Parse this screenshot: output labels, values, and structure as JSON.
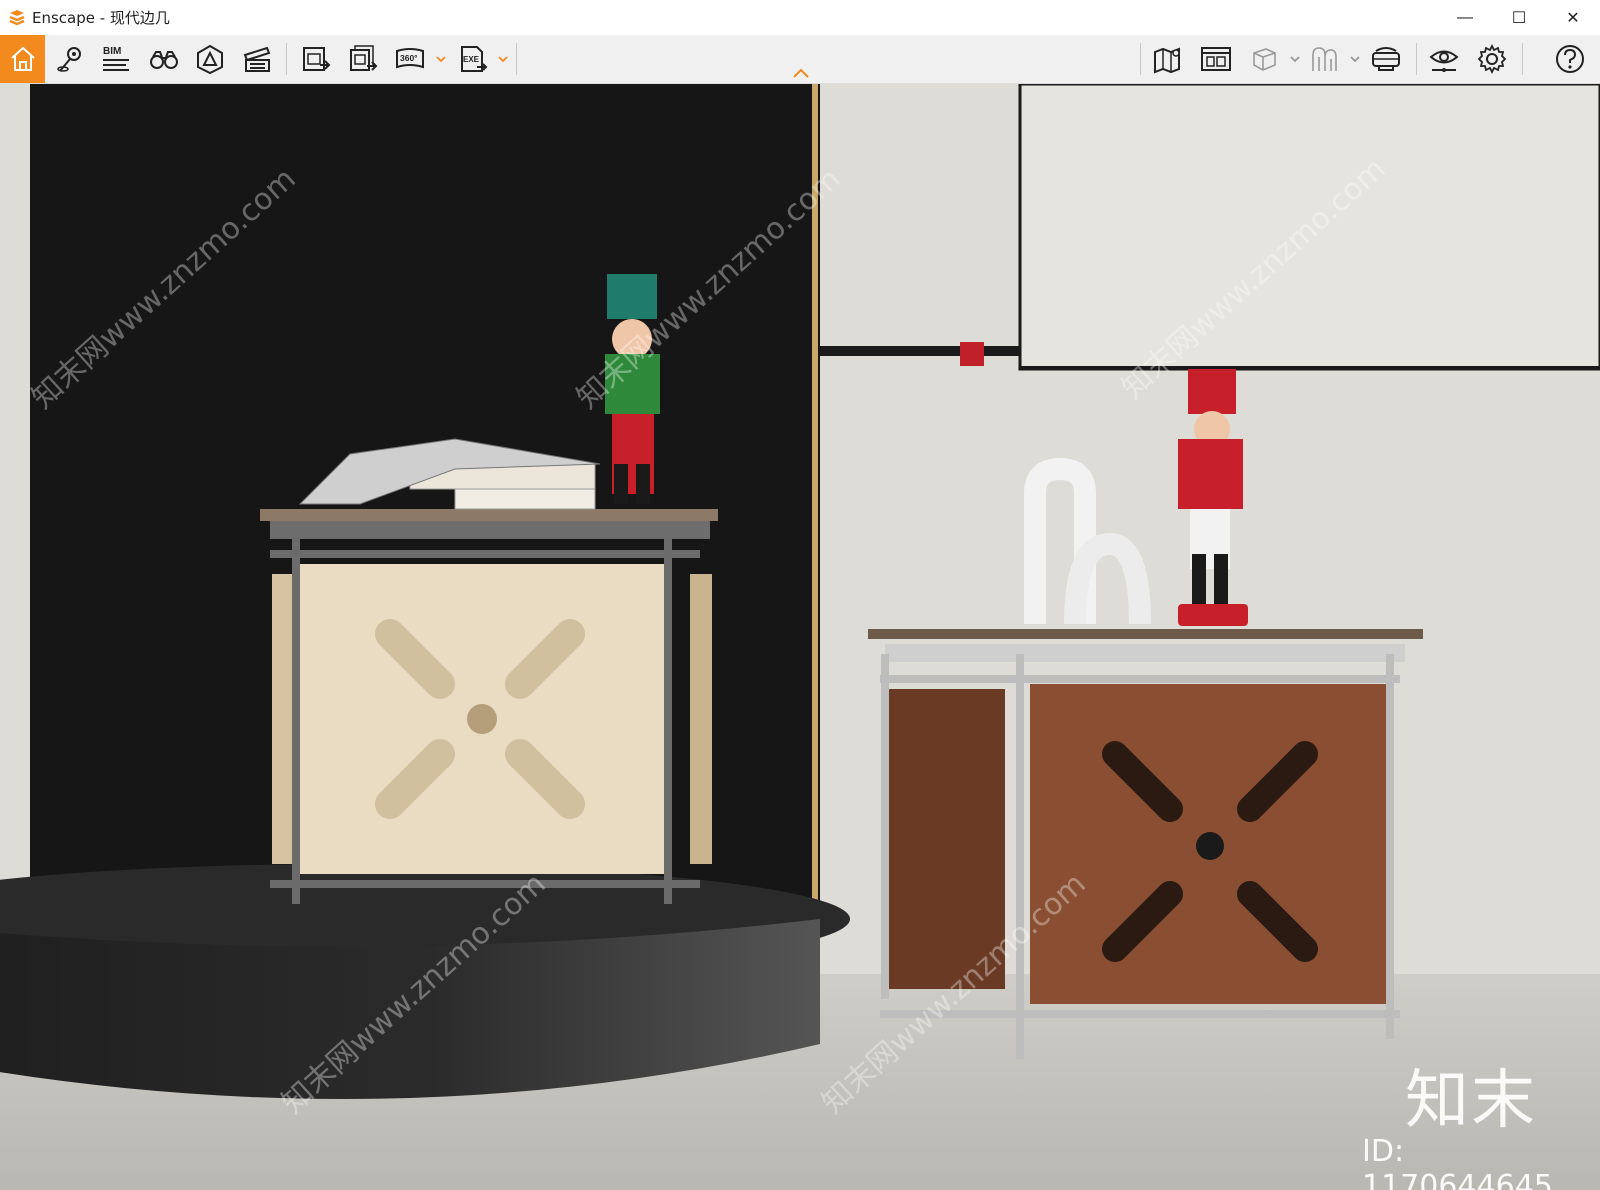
{
  "window": {
    "app_name": "Enscape",
    "title": "Enscape - 现代边几",
    "controls": {
      "minimize": "—",
      "maximize": "☐",
      "close": "✕"
    }
  },
  "toolbar": {
    "bim_label": "BIM",
    "pano_label": "360°",
    "exe_label": "EXE",
    "accent_color": "#f28a1e",
    "icons": [
      "home-icon",
      "location-pin-icon",
      "bim-info-icon",
      "binoculars-icon",
      "visual-settings-icon",
      "video-editor-icon",
      "render-image-icon",
      "batch-render-icon",
      "panorama-360-icon",
      "export-exe-icon",
      "map-icon",
      "asset-library-icon",
      "view-cube-icon",
      "material-icon",
      "vr-headset-icon",
      "view-eye-icon",
      "settings-gear-icon",
      "help-icon"
    ]
  },
  "viewport": {
    "watermark_logo": "知末",
    "watermark_id": "ID: 1170644645",
    "watermark_site": "知末网www.znzmo.com"
  }
}
